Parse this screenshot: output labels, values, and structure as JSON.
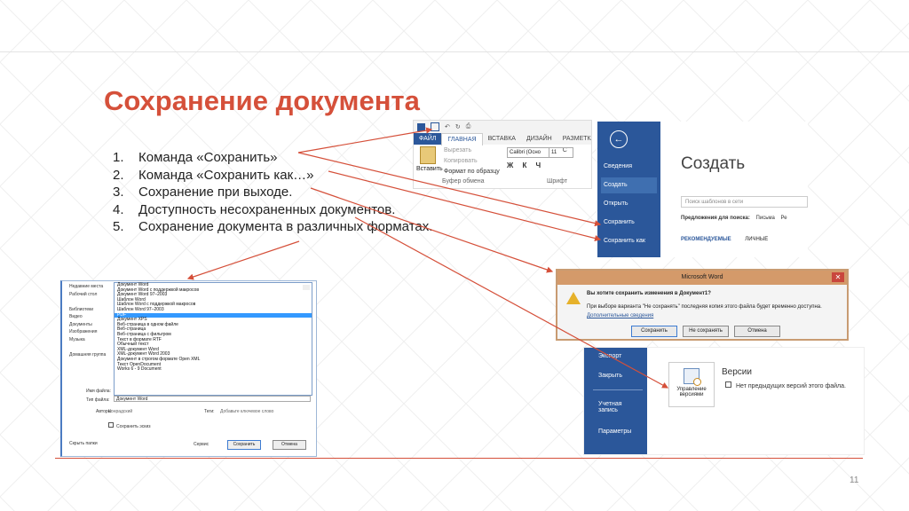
{
  "slide": {
    "title": "Сохранение документа",
    "number": "11",
    "items": [
      {
        "n": "1.",
        "text": "Команда «Сохранить»"
      },
      {
        "n": "2.",
        "text": "Команда «Сохранить как…»"
      },
      {
        "n": "3.",
        "text": "Сохранение при выходе."
      },
      {
        "n": "4.",
        "text": "Доступность несохраненных документов."
      },
      {
        "n": "5.",
        "text": "Сохранение документа в различных форматах."
      }
    ],
    "accent": "#d5503a"
  },
  "ribbon": {
    "tabs": [
      "ФАЙЛ",
      "ГЛАВНАЯ",
      "ВСТАВКА",
      "ДИЗАЙН",
      "РАЗМЕТКА С"
    ],
    "paste_label": "Вставить",
    "cut": "Вырезать",
    "copy": "Копировать",
    "format_painter": "Формат по образцу",
    "clipboard_group": "Буфер обмена",
    "font_name": "Calibri (Осно",
    "font_size": "11",
    "font_group": "Шрифт",
    "format_letters": "Ж К Ч"
  },
  "backstage": {
    "nav": [
      "Сведения",
      "Создать",
      "Открыть",
      "Сохранить",
      "Сохранить как"
    ],
    "heading": "Создать",
    "search_placeholder": "Поиск шаблонов в сети",
    "suggest_label": "Предложения для поиска:",
    "suggest_1": "Письма",
    "suggest_2": "Ре",
    "tab_recommended": "РЕКОМЕНДУЕМЫЕ",
    "tab_personal": "ЛИЧНЫЕ",
    "brand_color": "#2b579a"
  },
  "dialog": {
    "title": "Microsoft Word",
    "question": "Вы хотите сохранить изменения в Документ1?",
    "text": "При выборе варианта \"Не сохранять\" последняя копия этого файла будет временно доступна.",
    "link": "Дополнительные сведения",
    "btn_save": "Сохранить",
    "btn_dont_save": "Не сохранять",
    "btn_cancel": "Отмена",
    "close": "✕"
  },
  "versions": {
    "nav": [
      "Экспорт",
      "Закрыть",
      "Учетная запись",
      "Параметры"
    ],
    "button_label": "Управление версиями",
    "heading": "Версии",
    "text": "Нет предыдущих версий этого файла."
  },
  "saveas": {
    "nav": [
      "Недавние места",
      "Рабочий стол",
      "",
      "Библиотеки",
      "Видео",
      "Документы",
      "Изображения",
      "Музыка",
      "",
      "Домашняя группа"
    ],
    "formats": [
      "Документ Word",
      "Документ Word с поддержкой макросов",
      "Документ Word 97–2003",
      "Шаблон Word",
      "Шаблон Word с поддержкой макросов",
      "Шаблон Word 97–2003",
      "PDF",
      "Документ XPS",
      "Веб-страница в одном файле",
      "Веб-страница",
      "Веб-страница с фильтром",
      "Текст в формате RTF",
      "Обычный текст",
      "XML-документ Word",
      "XML-документ Word 2003",
      "Документ в строгом формате Open XML",
      "Текст OpenDocument",
      "Works 6 - 9 Document"
    ],
    "selected_index": 6,
    "file_name_label": "Имя файла:",
    "file_type_label": "Тип файла:",
    "file_type_value": "Документ Word",
    "authors_label": "Авторы:",
    "authors_value": "Конрадский",
    "tags_label": "Теги:",
    "tags_value": "Добавьте ключевое слово",
    "thumbnail_label": "Сохранить эскиз",
    "hide_folders": "Скрыть папки",
    "service": "Сервис",
    "save": "Сохранить",
    "cancel": "Отмена"
  }
}
